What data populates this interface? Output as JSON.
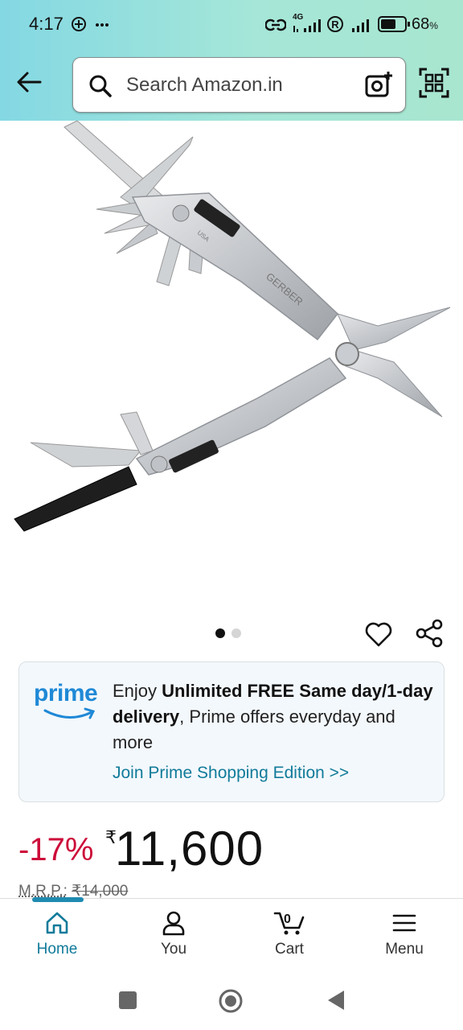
{
  "status_bar": {
    "time": "4:17",
    "icons": [
      "add-circle-icon",
      "more-icon",
      "link-icon",
      "signal-4g-icon",
      "r-badge-icon",
      "signal-icon",
      "battery-icon"
    ],
    "network": "4G",
    "battery_percent": "68",
    "battery_suffix": "%",
    "battery_level": 0.68
  },
  "header": {
    "search_placeholder": "Search Amazon.in"
  },
  "product_image": {
    "brand_mark": "GERBER",
    "origin_mark": "USA"
  },
  "carousel": {
    "total": 2,
    "active": 0
  },
  "prime_banner": {
    "logo": "prime",
    "text_prefix": "Enjoy ",
    "text_bold": "Unlimited FREE Same day/1-day delivery",
    "text_suffix": ", Prime offers everyday and more",
    "link": "Join Prime Shopping Edition >>"
  },
  "price": {
    "discount": "-17%",
    "currency": "₹",
    "amount": "11,600",
    "mrp_label": "M.R.P.:",
    "mrp_value": "₹14,000"
  },
  "bottom_nav": {
    "items": [
      {
        "label": "Home",
        "icon": "home-icon",
        "active": true
      },
      {
        "label": "You",
        "icon": "person-icon",
        "active": false
      },
      {
        "label": "Cart",
        "icon": "cart-icon",
        "active": false,
        "count": "0"
      },
      {
        "label": "Menu",
        "icon": "menu-icon",
        "active": false
      }
    ]
  },
  "colors": {
    "header_gradient_start": "#84d8e3",
    "header_gradient_end": "#a8e6cf",
    "discount_red": "#cc0c39",
    "link_teal": "#117b9a",
    "prime_blue": "#1f89d6"
  }
}
